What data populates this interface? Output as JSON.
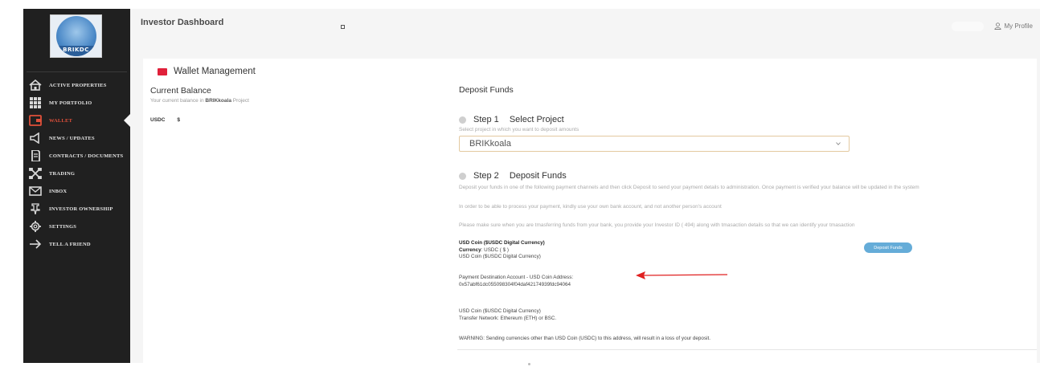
{
  "app": {
    "title": "Investor Dashboard",
    "profile_label": "My Profile"
  },
  "logo": {
    "text": "BRIKDC"
  },
  "sidebar": {
    "items": [
      {
        "label": "ACTIVE PROPERTIES",
        "icon": "home-icon",
        "active": false
      },
      {
        "label": "MY PORTFOLIO",
        "icon": "grid-icon",
        "active": false
      },
      {
        "label": "WALLET",
        "icon": "wallet-icon",
        "active": true
      },
      {
        "label": "NEWS / UPDATES",
        "icon": "megaphone-icon",
        "active": false
      },
      {
        "label": "CONTRACTS / DOCUMENTS",
        "icon": "document-icon",
        "active": false
      },
      {
        "label": "TRADING",
        "icon": "trading-icon",
        "active": false
      },
      {
        "label": "INBOX",
        "icon": "mail-icon",
        "active": false
      },
      {
        "label": "INVESTOR OWNERSHIP",
        "icon": "pin-icon",
        "active": false
      },
      {
        "label": "SETTINGS",
        "icon": "gear-icon",
        "active": false
      },
      {
        "label": "TELL A FRIEND",
        "icon": "arrow-right-icon",
        "active": false
      }
    ]
  },
  "wallet": {
    "title": "Wallet Management",
    "current_balance_title": "Current Balance",
    "current_balance_sub_prefix": "Your current balance in",
    "current_balance_project": "BRIKkoala",
    "current_balance_sub_suffix": "Project",
    "currency": "USDC",
    "currency_symbol": "$"
  },
  "deposit": {
    "title": "Deposit Funds",
    "step1": {
      "num": "Step 1",
      "title": "Select Project",
      "sub": "Select project in which you want to deposit amounts",
      "selected_project": "BRIKkoala"
    },
    "step2": {
      "num": "Step 2",
      "title": "Deposit Funds",
      "sub": "Deposit your funds in one of the following payment channels and then click Deposit to send your payment details to administration. Once payment is verified your balance will be updated in the system",
      "para1": "In order to be able to process your payment, kindly use your own bank account, and not another person's account",
      "para2": "Please make sure when you are tmasferring funds from your bank, you provide your Investor ID ( 494) along with tmasaction details so that we can identify your tmasaction"
    },
    "coin": {
      "name": "USD Coin ($USDC Digital Currency)",
      "currency_label": "Currency",
      "currency_value": ": USDC ( $ )",
      "name_repeat": "USD Coin ($USDC Digital Currency)",
      "dest_label": "Payment Destination Account - USD Coin Address:",
      "address": "0x57abf61dc055098304f04daf42174939fdc94064",
      "name_repeat2": "USD Coin ($USDC Digital Currency)",
      "network": "Transfer Network: Ethereum (ETH) or BSC.",
      "warning": "WARNING: Sending currencies other than USD Coin (USDC) to this address, will result in a loss of your deposit."
    },
    "deposit_button": "Deposit Funds"
  },
  "colors": {
    "sidebar_bg": "#202020",
    "accent_red": "#e0203a",
    "active_nav": "#e0503a",
    "button_blue": "#65acd8"
  }
}
